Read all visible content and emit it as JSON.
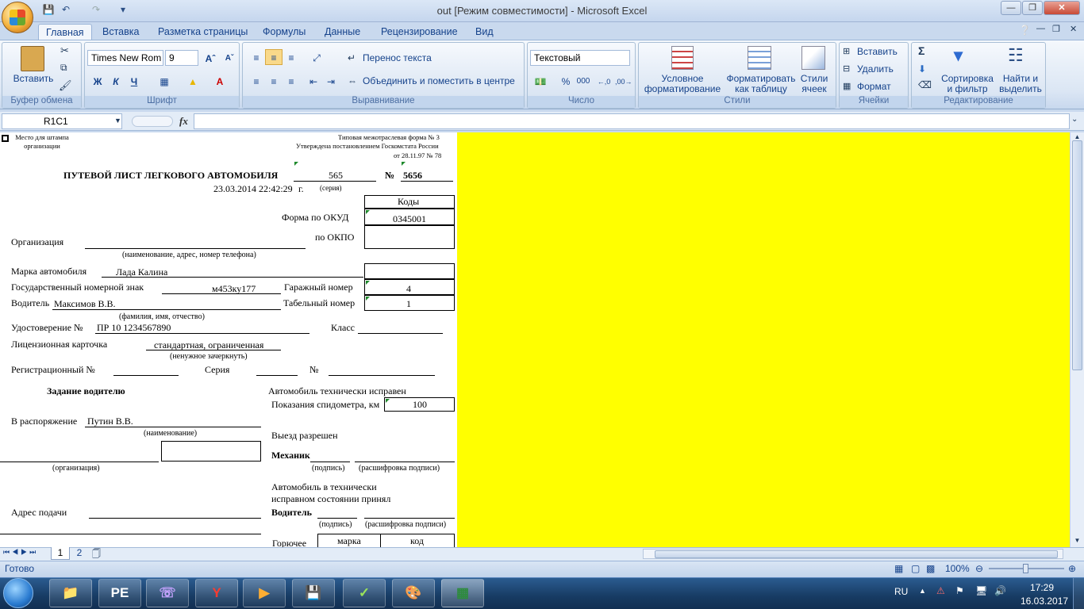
{
  "window": {
    "title": "out  [Режим совместимости] - Microsoft Excel"
  },
  "tabs": [
    "Главная",
    "Вставка",
    "Разметка страницы",
    "Формулы",
    "Данные",
    "Рецензирование",
    "Вид"
  ],
  "ribbon": {
    "clipboard": {
      "paste": "Вставить",
      "label": "Буфер обмена"
    },
    "font": {
      "name": "Times New Rom",
      "size": "9",
      "label": "Шрифт",
      "bold": "Ж",
      "italic": "К",
      "underline": "Ч"
    },
    "alignment": {
      "wrap": "Перенос текста",
      "merge": "Объединить и поместить в центре",
      "label": "Выравнивание"
    },
    "number": {
      "format": "Текстовый",
      "percent": "%",
      "thousands": "000",
      "label": "Число"
    },
    "styles": {
      "conditional": "Условное форматирование",
      "as_table": "Форматировать как таблицу",
      "cell_styles": "Стили ячеек",
      "label": "Стили"
    },
    "cells": {
      "insert": "Вставить",
      "delete": "Удалить",
      "format": "Формат",
      "label": "Ячейки"
    },
    "editing": {
      "sort": "Сортировка и фильтр",
      "find": "Найти и выделить",
      "label": "Редактирование"
    }
  },
  "formula_bar": {
    "name_box": "R1C1",
    "fx": "fx",
    "value": ""
  },
  "document": {
    "stamp_place": "Место для штампа организации",
    "form_type": "Типовая  межотраслевая форма № 3",
    "approved": "Утверждена постановлением Госкомстата России",
    "approved_date": "от  28.11.97  №  78",
    "title": "ПУТЕВОЙ ЛИСТ ЛЕГКОВОГО АВТОМОБИЛЯ",
    "series": "565",
    "number_sign": "№",
    "number": "5656",
    "series_caption": "(серия)",
    "datetime": "23.03.2014 22:42:29",
    "year_suffix": "г.",
    "codes_header": "Коды",
    "okud_label": "Форма по ОКУД",
    "okud_value": "0345001",
    "okpo_label": "по ОКПО",
    "org_label": "Организация",
    "org_caption": "(наименование, адрес, номер телефона)",
    "car_make_label": "Марка автомобиля",
    "car_make": "Лада Калина",
    "plate_label": "Государственный номерной знак",
    "plate": "м453ку177",
    "garage_label": "Гаражный номер",
    "garage_value": "4",
    "driver_label": "Водитель",
    "driver": "Максимов В.В.",
    "tabel_label": "Табельный номер",
    "tabel_value": "1",
    "fio_caption": "(фамилия, имя, отчество)",
    "license_label": "Удостоверение №",
    "license": "ПР 10 1234567890",
    "class_label": "Класс",
    "card_label": "Лицензионная карточка",
    "card_value": "стандартная, ограниченная",
    "card_caption": "(ненужное зачеркнуть)",
    "reg_label": "Регистрационный №",
    "series_label": "Серия",
    "num_label": "№",
    "task_header": "Задание водителю",
    "tech_ok": "Автомобиль технически исправен",
    "speedo_label": "Показания спидометра,  км",
    "speedo_value": "100",
    "disposal_label": "В распоряжение",
    "disposal_value": "Путин В.В.",
    "name_caption": "(наименование)",
    "exit_allowed": "Выезд разрешен",
    "mechanic_label": "Механик",
    "org_caption2": "(организация)",
    "sign_caption": "(подпись)",
    "sign_decode": "(расшифровка подписи)",
    "accepted_1": "Автомобиль в технически",
    "accepted_2": "исправном состоянии принял",
    "address_label": "Адрес подачи",
    "driver_label2": "Водитель",
    "sign_caption2": "(подпись)",
    "sign_decode2": "(расшифровка подписи)",
    "fuel_label": "Горючее",
    "fuel_brand": "марка",
    "fuel_code": "код"
  },
  "sheet_tabs": [
    "1",
    "2"
  ],
  "status": {
    "ready": "Готово",
    "zoom": "100%"
  },
  "taskbar": {
    "lang": "RU",
    "time": "17:29",
    "date": "16.03.2017"
  }
}
